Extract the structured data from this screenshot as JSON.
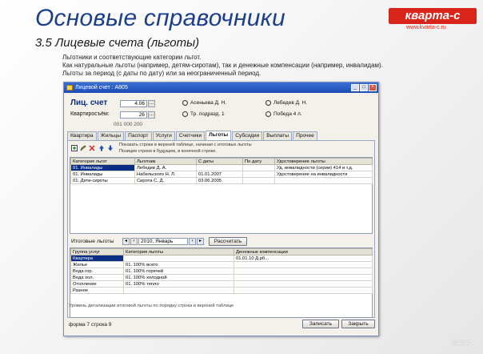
{
  "slide": {
    "title": "Основые справочники",
    "subtitle": "3.5  Лицевые счета (льготы)",
    "logo_main": "кварта-с",
    "logo_sub": "www.kvarta-c.ru",
    "intro": [
      "Льготники и соответствующие категории льгот.",
      "Как натуральные льготы (например, детям-сиротам), так и денежные компенсации (например, инвалидам).",
      "Льготы за период (с даты по дату) или за неограниченный период."
    ]
  },
  "window": {
    "title": "Лицевой счет : А805",
    "account_label": "Лиц. счет",
    "account_value": "4.06",
    "account_code": "А805",
    "tenant_label": "Квартиросъём:",
    "tenant_value": "26",
    "tenant_code": "001 000 200",
    "person_label": "Асеньева Д. Н.",
    "street_label": "Победа 4 л.",
    "person2_label": "Тр. Победы 4 л.",
    "person2_value": "Победа 4. Л.",
    "owner_label": "Лебедев Д. Н.",
    "reg_label": "Тр. подразд. 1"
  },
  "tabs": [
    {
      "label": "Квартира"
    },
    {
      "label": "Жильцы"
    },
    {
      "label": "Паспорт"
    },
    {
      "label": "Услуги"
    },
    {
      "label": "Счетчики"
    },
    {
      "label": "Льготы"
    },
    {
      "label": "Субсидии"
    },
    {
      "label": "Выплаты"
    },
    {
      "label": "Прочее"
    }
  ],
  "notes": {
    "line1": "Показать строки в верхней таблице, начиная с итоговых льготы",
    "line2": "Позиция строки в будущем, в конечной строке."
  },
  "upper_table": {
    "headers": [
      "Категория льгот",
      "Льготник",
      "С даты",
      "По дату",
      "Удостоверение льготы"
    ],
    "rows": [
      [
        "01. Инвалиды",
        "Лебедев Д. А.",
        "",
        "",
        "Уд. инвалидности (серии) 414 и т.д."
      ],
      [
        "01. Инвалиды",
        "Набельского Н. Л.",
        "01.01.2007",
        "",
        "Удостоверение на инвалидности"
      ],
      [
        "01. Дети-сироты",
        "Сирота С. Д.",
        "03.06.2005",
        "",
        ""
      ]
    ]
  },
  "summary": {
    "label": "Итоговые льготы",
    "period": "2010, Январь",
    "recalc_button": "Рассчитать"
  },
  "lower_table": {
    "headers": [
      "Группа услуг",
      "Категория льготы",
      "Денежные компенсации"
    ],
    "rows": [
      [
        "Квартира",
        "",
        "01.01.10 Д.рб..."
      ],
      [
        "Жилье",
        "01. 100% всего",
        ""
      ],
      [
        "Вода гор.",
        "01. 100% горячей",
        ""
      ],
      [
        "Вода хол.",
        "01. 100% холодной",
        ""
      ],
      [
        "Отопление",
        "01. 100% тепло",
        ""
      ],
      [
        "Разное",
        "",
        ""
      ]
    ]
  },
  "footnote": "Уровень детализации итоговой льготы по порядку строка в верхней таблице",
  "status": {
    "left": "форма 7 строка 9",
    "ok_button": "Записать",
    "close_button": "Закрыть"
  },
  "corner_mark": "Kvarta-C"
}
